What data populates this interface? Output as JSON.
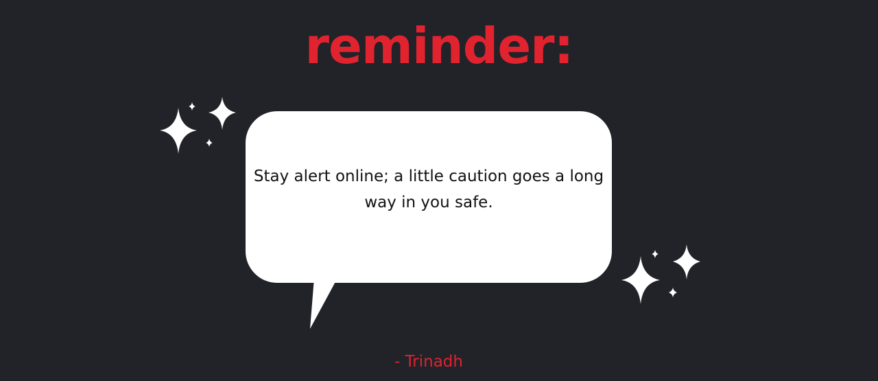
{
  "heading": "reminder:",
  "quote": "Stay alert online; a little caution goes a long way in you safe.",
  "author": "- Trinadh",
  "colors": {
    "background": "#212328",
    "accent": "#e0232f",
    "bubble": "#ffffff",
    "text": "#111111"
  },
  "icons": {
    "left": "sparkles-icon",
    "right": "sparkles-icon"
  }
}
